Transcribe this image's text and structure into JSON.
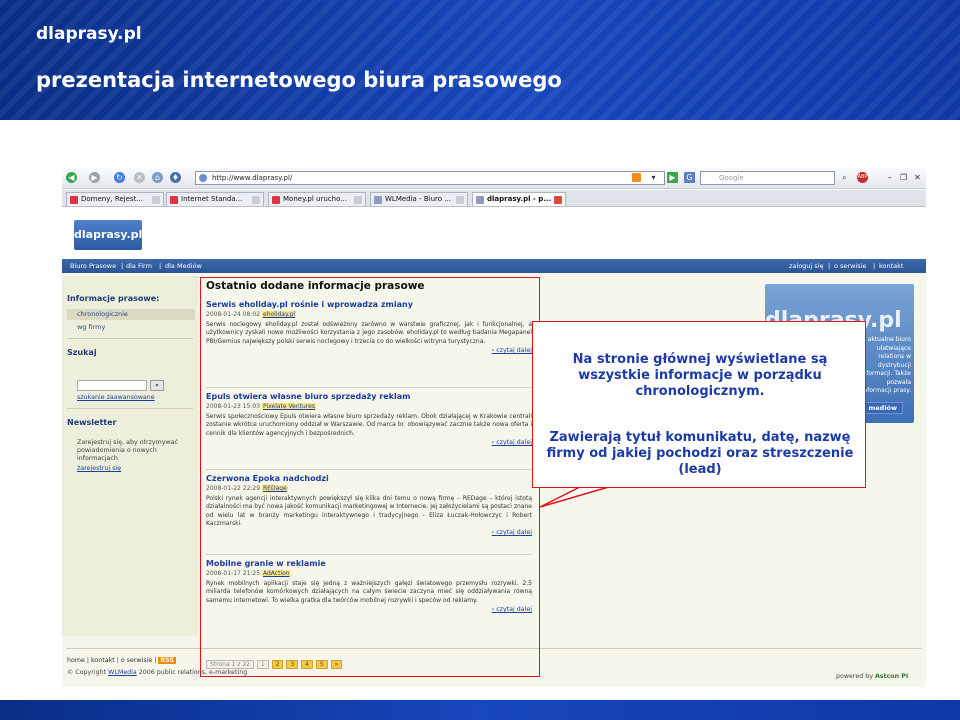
{
  "slide": {
    "site_name": "dlaprasy.pl",
    "title": "prezentacja internetowego biura prasowego"
  },
  "browser": {
    "url": "http://www.dlaprasy.pl/",
    "search_placeholder": "Google",
    "tabs": [
      {
        "label": "Domeny, Rejest...",
        "active": false
      },
      {
        "label": "Internet Standa...",
        "active": false
      },
      {
        "label": "Money.pl urucho...",
        "active": false
      },
      {
        "label": "WLMedia - Biuro ...",
        "active": false
      },
      {
        "label": "dlaprasy.pl - p...",
        "active": true
      }
    ]
  },
  "site": {
    "logo": "dlaprasy.pl",
    "nav_left": [
      "Biuro Prasowe",
      "dla Firm",
      "dla Mediów"
    ],
    "nav_right": [
      "zaloguj się",
      "o serwisie",
      "kontakt"
    ],
    "sidebar": {
      "info_heading": "Informacje prasowe:",
      "info_items": [
        "chronologicznie",
        "wg firmy"
      ],
      "search_heading": "Szukaj",
      "search_go": "»",
      "search_advanced": "szukanie zaawansowane",
      "newsletter_heading": "Newsletter",
      "newsletter_text": "Zarejestruj się, aby otrzymywać powiadomienia o nowych informacjach",
      "newsletter_link": "zarejestruj się"
    },
    "content_title": "Ostatnio dodane informacje prasowe",
    "read_more": "czytaj dalej",
    "articles": [
      {
        "title": "Serwis eholiday.pl rośnie i wprowadza zmiany",
        "date": "2008-01-24 08:02",
        "source": "eholiday.pl",
        "lead": "Serwis noclegowy eholiday.pl został odświeżony zarówno w warstwie graficznej, jak i funkcjonalnej, a użytkownicy zyskali nowe możliwości korzystania z jego zasobów. eholiday.pl to według badania Megapanel PBI/Gemius największy polski serwis noclegowy i trzecia co do wielkości witryna turystyczna."
      },
      {
        "title": "Epuls otwiera własne biuro sprzedaży reklam",
        "date": "2008-01-23 15:03",
        "source": "Pixelate Ventures",
        "lead": "Serwis społecznościowy Epuls otwiera własne biuro sprzedaży reklam. Obok działającej w Krakowie centrali zostanie wkrótce uruchomiony oddział w Warszawie. Od marca br. obowiązywać zacznie także nowa oferta i cennik dla klientów agencyjnych i bezpośrednich."
      },
      {
        "title": "Czerwona Epoka nadchodzi",
        "date": "2008-01-22 22:29",
        "source": "REDage",
        "lead": "Polski rynek agencji interaktywnych powiększył się kilka dni temu o nową firmę – REDage – której istotą działalności ma być nowa jakość komunikacji marketingowej w Internecie. Jej założycielami są postaci znane od wielu lat w branży marketingu interaktywnego i tradycyjnego - Eliza Łuczak-Hołowczyc i Robert Kaczmarski."
      },
      {
        "title": "Mobilne granie w reklamie",
        "date": "2008-01-17 21:25",
        "source": "AdAction",
        "lead": "Rynek mobilnych aplikacji staje się jedną z ważniejszych gałęzi światowego przemysłu rozrywki. 2.5 miliarda telefonów komórkowych działających na całym świecie zaczyna mieć się oddziaływania równą samemu internetowi. To wielka gratka dla twórców mobilnej rozrywki i speców od reklamy."
      }
    ],
    "pager": {
      "label": "Strona 1 z 22",
      "pages": [
        "1",
        "2",
        "3",
        "4",
        "5",
        "»"
      ]
    },
    "banner": {
      "logo_text": "dlaprasy.pl",
      "text": "aktualne biuro ułatwiające relations w dystrybucji informacji. Także pozwala informacji prasy.",
      "button": "dla mediów"
    },
    "footer": {
      "links": [
        "home",
        "kontakt",
        "o serwisie",
        "RSS"
      ],
      "copyright": "© Copyright",
      "owner": "WLMedia",
      "copyright_rest": "2006 public relations, e-marketing",
      "powered": "powered by",
      "powered_by": "Astcon PI"
    }
  },
  "callout": {
    "p1": "Na stronie głównej wyświetlane są wszystkie informacje w porządku chronologicznym.",
    "p2": "Zawierają tytuł komunikatu, datę, nazwę firmy od jakiej pochodzi oraz streszczenie (lead)"
  }
}
